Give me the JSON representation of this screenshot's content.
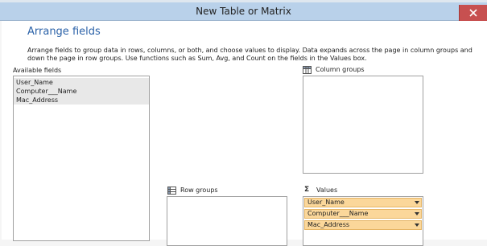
{
  "window": {
    "title": "New Table or Matrix"
  },
  "page": {
    "heading": "Arrange fields",
    "instructions": "Arrange fields to group data in rows, columns, or both, and choose values to display. Data expands across the page in column groups and down the page in row groups.  Use functions such as Sum, Avg, and Count on the fields in the Values box."
  },
  "available_fields": {
    "label": "Available fields",
    "items": [
      "User_Name",
      "Computer___Name",
      "Mac_Address"
    ]
  },
  "column_groups": {
    "label": "Column groups"
  },
  "row_groups": {
    "label": "Row groups"
  },
  "values": {
    "label": "Values",
    "items": [
      "User_Name",
      "Computer___Name",
      "Mac_Address"
    ]
  },
  "colors": {
    "title_bar": "#b9d1ea",
    "heading": "#2b62a8",
    "value_item": "#fbd79a"
  }
}
